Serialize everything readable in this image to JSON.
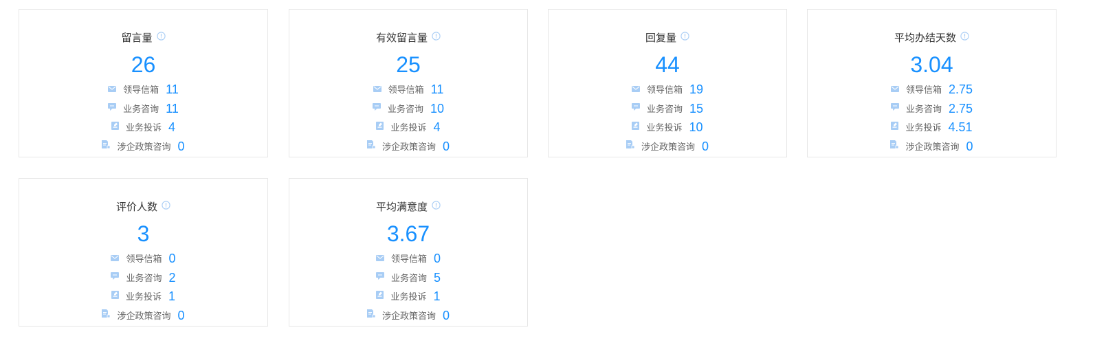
{
  "cards": [
    {
      "title": "留言量",
      "value": "26",
      "rows": [
        {
          "icon": "mail-icon",
          "label": "领导信箱",
          "value": "11"
        },
        {
          "icon": "chat-icon",
          "label": "业务咨询",
          "value": "11"
        },
        {
          "icon": "complaint-icon",
          "label": "业务投诉",
          "value": "4"
        },
        {
          "icon": "policy-icon",
          "label": "涉企政策咨询",
          "value": "0"
        }
      ]
    },
    {
      "title": "有效留言量",
      "value": "25",
      "rows": [
        {
          "icon": "mail-icon",
          "label": "领导信箱",
          "value": "11"
        },
        {
          "icon": "chat-icon",
          "label": "业务咨询",
          "value": "10"
        },
        {
          "icon": "complaint-icon",
          "label": "业务投诉",
          "value": "4"
        },
        {
          "icon": "policy-icon",
          "label": "涉企政策咨询",
          "value": "0"
        }
      ]
    },
    {
      "title": "回复量",
      "value": "44",
      "rows": [
        {
          "icon": "mail-icon",
          "label": "领导信箱",
          "value": "19"
        },
        {
          "icon": "chat-icon",
          "label": "业务咨询",
          "value": "15"
        },
        {
          "icon": "complaint-icon",
          "label": "业务投诉",
          "value": "10"
        },
        {
          "icon": "policy-icon",
          "label": "涉企政策咨询",
          "value": "0"
        }
      ]
    },
    {
      "title": "平均办结天数",
      "value": "3.04",
      "rows": [
        {
          "icon": "mail-icon",
          "label": "领导信箱",
          "value": "2.75"
        },
        {
          "icon": "chat-icon",
          "label": "业务咨询",
          "value": "2.75"
        },
        {
          "icon": "complaint-icon",
          "label": "业务投诉",
          "value": "4.51"
        },
        {
          "icon": "policy-icon",
          "label": "涉企政策咨询",
          "value": "0"
        }
      ]
    },
    {
      "title": "评价人数",
      "value": "3",
      "rows": [
        {
          "icon": "mail-icon",
          "label": "领导信箱",
          "value": "0"
        },
        {
          "icon": "chat-icon",
          "label": "业务咨询",
          "value": "2"
        },
        {
          "icon": "complaint-icon",
          "label": "业务投诉",
          "value": "1"
        },
        {
          "icon": "policy-icon",
          "label": "涉企政策咨询",
          "value": "0"
        }
      ]
    },
    {
      "title": "平均满意度",
      "value": "3.67",
      "rows": [
        {
          "icon": "mail-icon",
          "label": "领导信箱",
          "value": "0"
        },
        {
          "icon": "chat-icon",
          "label": "业务咨询",
          "value": "5"
        },
        {
          "icon": "complaint-icon",
          "label": "业务投诉",
          "value": "1"
        },
        {
          "icon": "policy-icon",
          "label": "涉企政策咨询",
          "value": "0"
        }
      ]
    }
  ],
  "colors": {
    "accent": "#1890ff",
    "icon": "#a8cdf5",
    "border": "#e6e6e6",
    "title": "#333333",
    "label": "#666666"
  }
}
